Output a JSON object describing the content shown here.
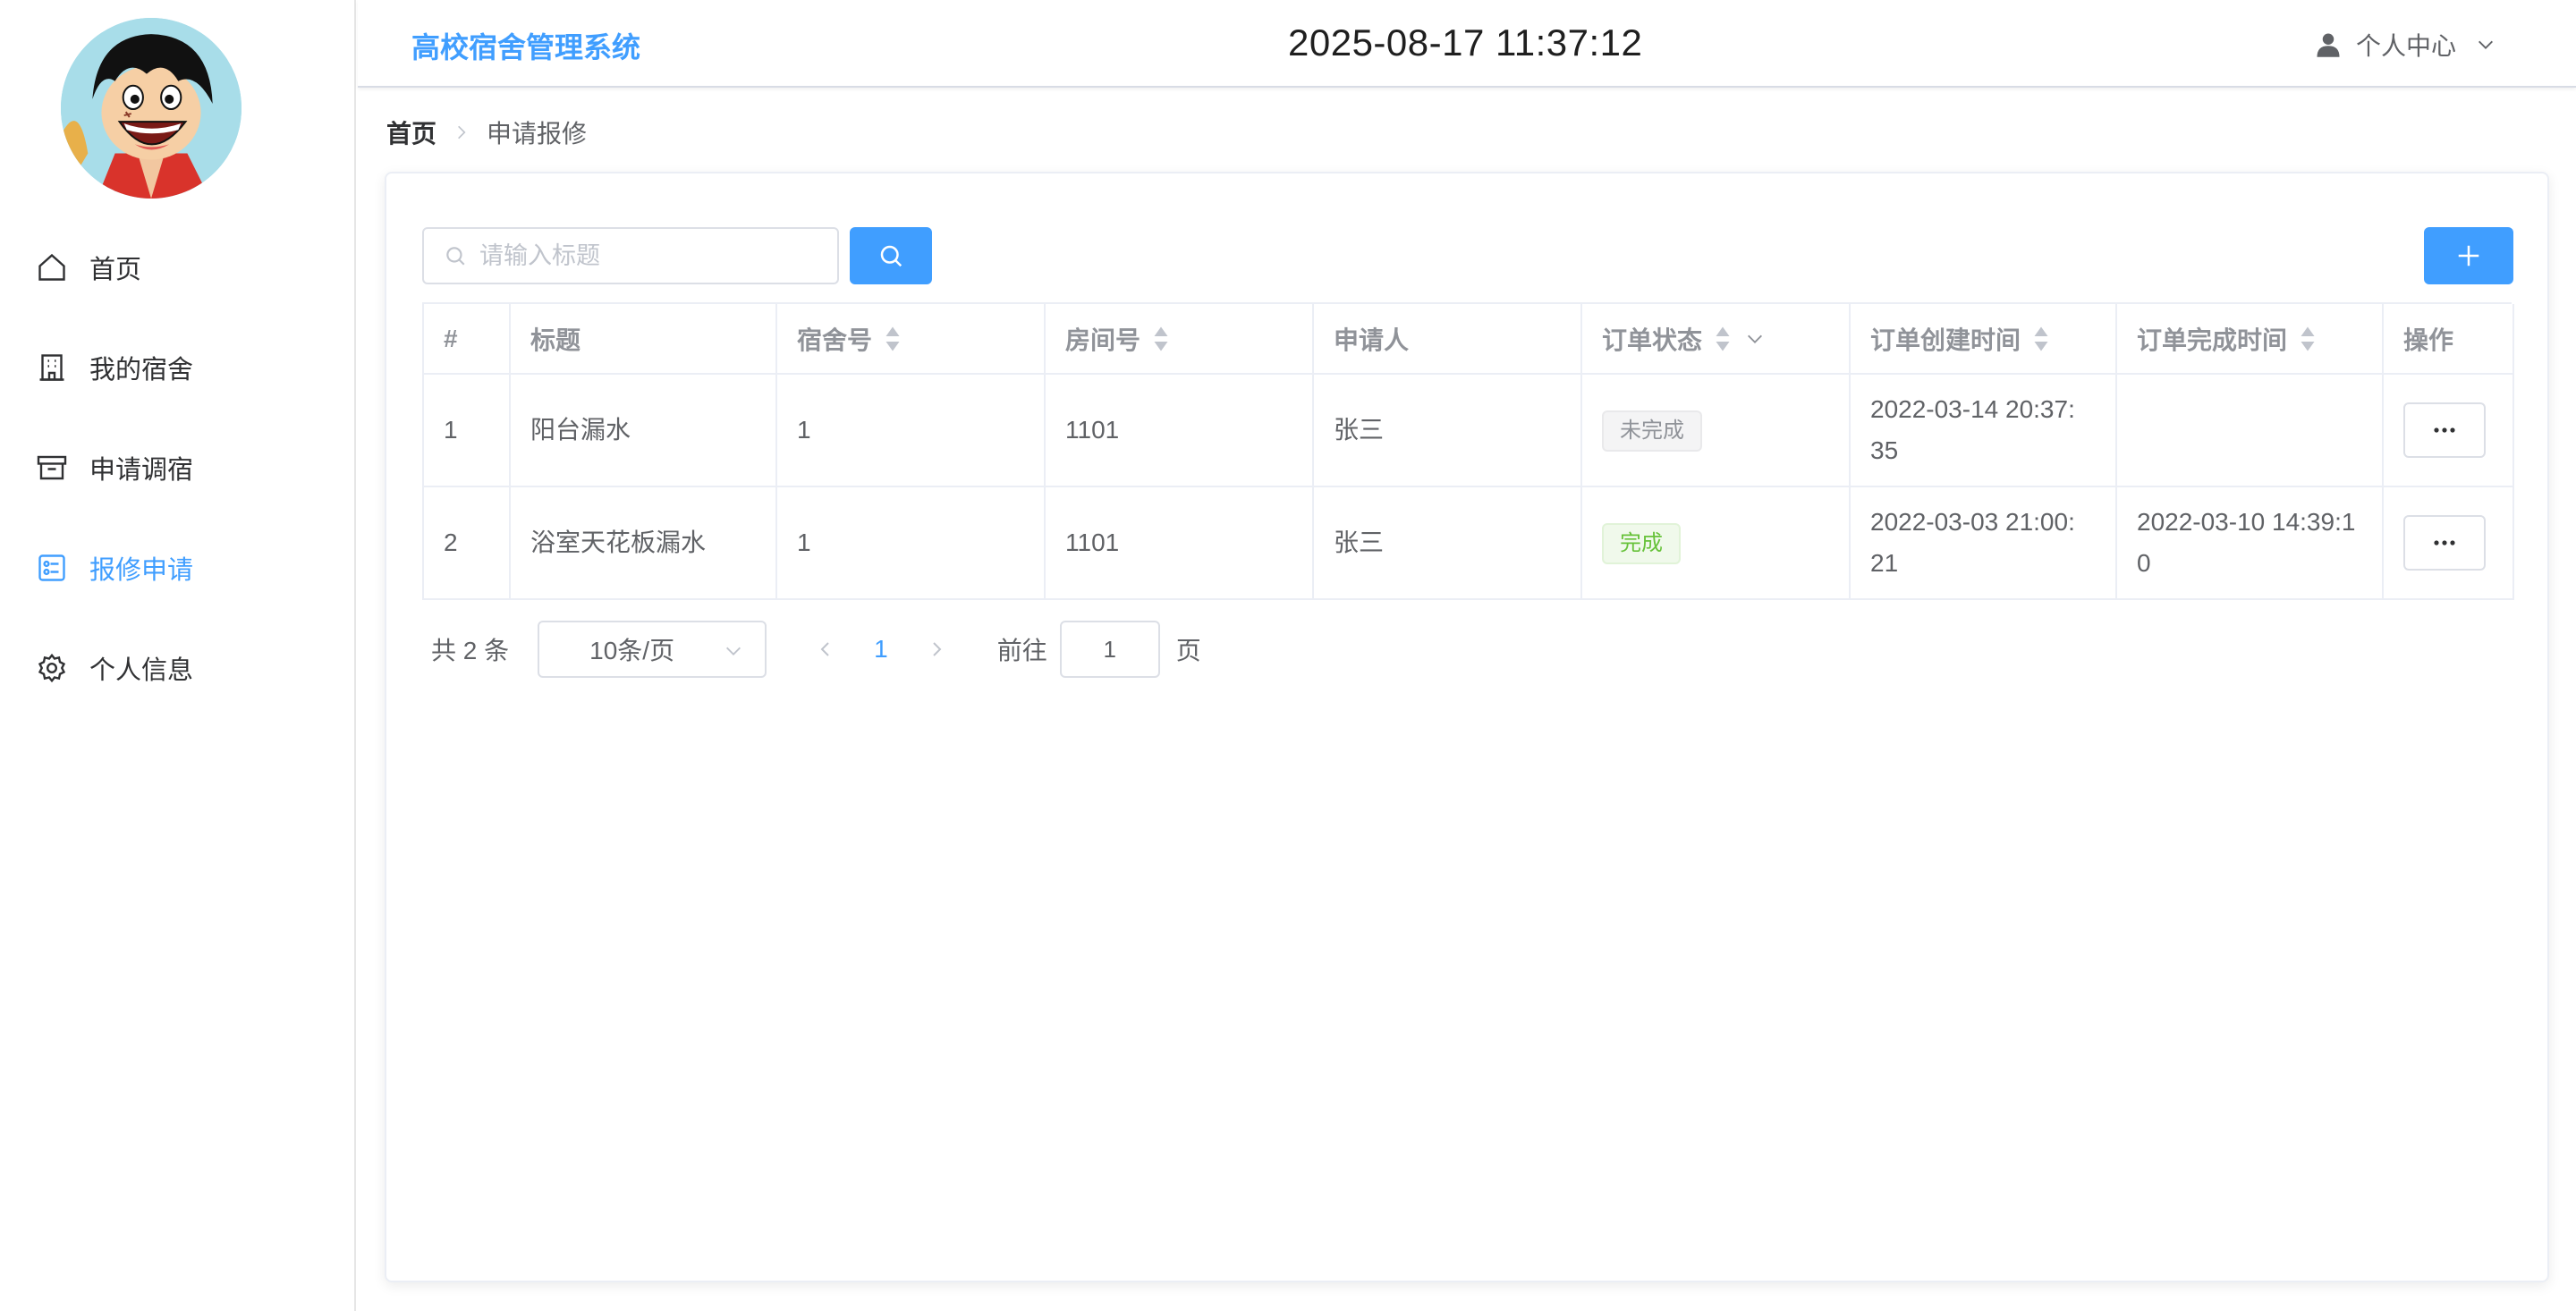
{
  "header": {
    "system_title": "高校宿舍管理系统",
    "datetime": "2025-08-17 11:37:12",
    "user_center_label": "个人中心"
  },
  "sidebar": {
    "items": [
      {
        "label": "首页",
        "icon": "home-icon",
        "active": false
      },
      {
        "label": "我的宿舍",
        "icon": "building-icon",
        "active": false
      },
      {
        "label": "申请调宿",
        "icon": "box-icon",
        "active": false
      },
      {
        "label": "报修申请",
        "icon": "tickets-icon",
        "active": true
      },
      {
        "label": "个人信息",
        "icon": "gear-icon",
        "active": false
      }
    ]
  },
  "breadcrumb": {
    "home": "首页",
    "current": "申请报修"
  },
  "search": {
    "placeholder": "请输入标题"
  },
  "table": {
    "headers": {
      "index": "#",
      "title": "标题",
      "dorm": "宿舍号",
      "room": "房间号",
      "applicant": "申请人",
      "status": "订单状态",
      "created": "订单创建时间",
      "finished": "订单完成时间",
      "actions": "操作"
    },
    "rows": [
      {
        "index": "1",
        "title": "阳台漏水",
        "dorm": "1",
        "room": "1101",
        "applicant": "张三",
        "status": "未完成",
        "created_line1": "2022-03-14 20:37:",
        "created_line2": "35",
        "finished_line1": "",
        "finished_line2": ""
      },
      {
        "index": "2",
        "title": "浴室天花板漏水",
        "dorm": "1",
        "room": "1101",
        "applicant": "张三",
        "status": "完成",
        "created_line1": "2022-03-03 21:00:",
        "created_line2": "21",
        "finished_line1": "2022-03-10 14:39:1",
        "finished_line2": "0"
      }
    ]
  },
  "pagination": {
    "total": "共 2 条",
    "page_size": "10条/页",
    "current_page": "1",
    "goto_label": "前往",
    "goto_value": "1",
    "page_unit": "页"
  },
  "colors": {
    "accent": "#409eff",
    "status_pending": "#909399",
    "status_done": "#67c23a"
  }
}
